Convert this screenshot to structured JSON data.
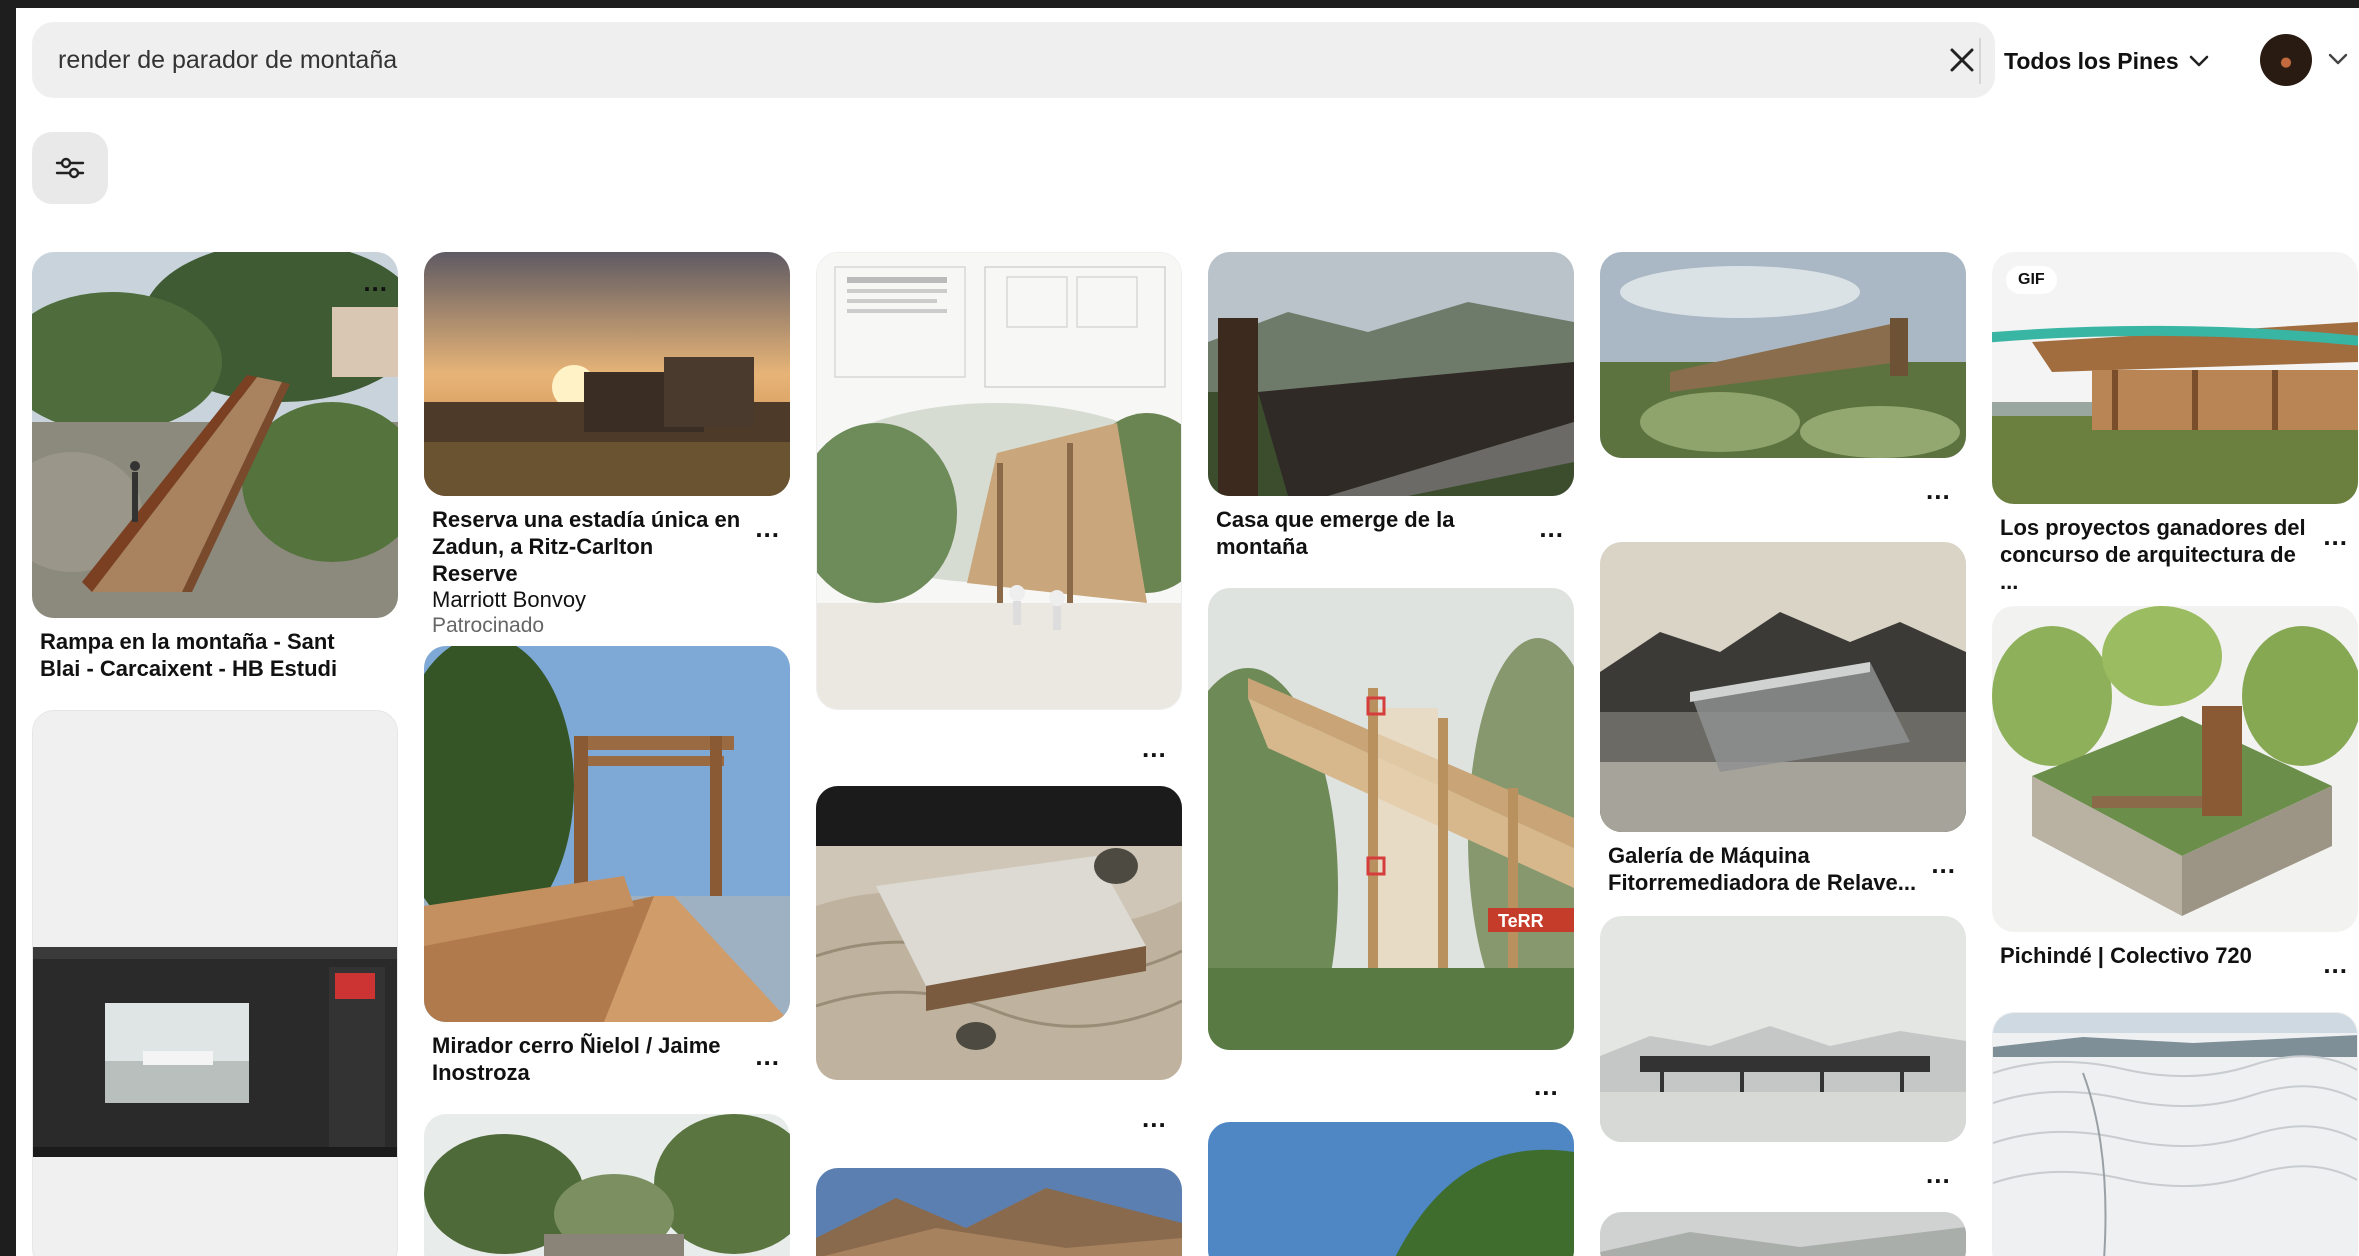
{
  "search": {
    "query": "render de parador de montaña",
    "scope_label": "Todos los Pines"
  },
  "colors": {
    "background": "#1e1e1e",
    "surface": "#efefef",
    "accent_stroke": "#39b5a4"
  },
  "icons": {
    "clear": "close-icon",
    "scope": "chevron-down-icon",
    "profile": "avatar",
    "account_menu": "chevron-down-icon",
    "filters": "sliders-icon",
    "more": "more-options-icon"
  },
  "pins": [
    {
      "title": "Rampa en la montaña - Sant Blai - Carcaixent - HB Estudi",
      "more": "..."
    },
    {
      "title": "Reserva una estadía única en Zadun, a Ritz-Carlton Reserve",
      "advertiser": "Marriott Bonvoy",
      "sponsored": "Patrocinado",
      "more": "..."
    },
    {
      "title": "Mirador cerro Ñielol / Jaime Inostroza",
      "more": "..."
    },
    {
      "title": "Casa que emerge de la montaña",
      "more": "..."
    },
    {
      "title": "Galería de Máquina Fitorremediadora de Relave...",
      "more": "..."
    },
    {
      "title": "Los proyectos ganadores del concurso de arquitectura de ...",
      "badge": "GIF",
      "more": "..."
    },
    {
      "title": "Pichindé | Colectivo 720",
      "more": "..."
    }
  ],
  "image_text": {
    "sign": "TeRR"
  },
  "more_label": "..."
}
